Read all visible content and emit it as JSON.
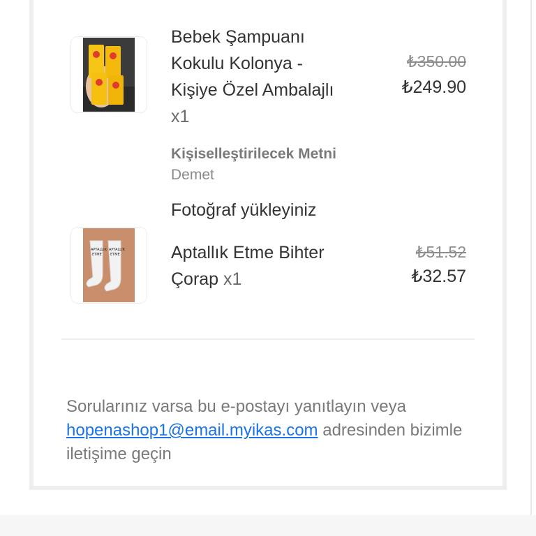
{
  "items": [
    {
      "name_lines": [
        "Bebek Şampuanı",
        "Kokulu Kolonya -",
        "Kişiye Özel Ambalajlı"
      ],
      "quantity": "x1",
      "old_price": "₺350.00",
      "new_price": "₺249.90",
      "custom_label": "Kişiselleştirilecek Metni",
      "custom_value": "Demet",
      "extra_label": "Fotoğraf yükleyiniz"
    },
    {
      "name_lines": [
        "Aptallık Etme Bihter",
        "Çorap"
      ],
      "quantity": "x1",
      "old_price": "₺51.52",
      "new_price": "₺32.57"
    }
  ],
  "footer": {
    "text_before": "Sorularınız varsa bu e-postayı yanıtlayın veya",
    "email": "hopenashop1@email.myikas.com",
    "text_after": "adresinden bizimle iletişime geçin"
  },
  "colors": {
    "link": "#1a73e8",
    "text": "#333333",
    "muted": "#7a7a7a"
  }
}
